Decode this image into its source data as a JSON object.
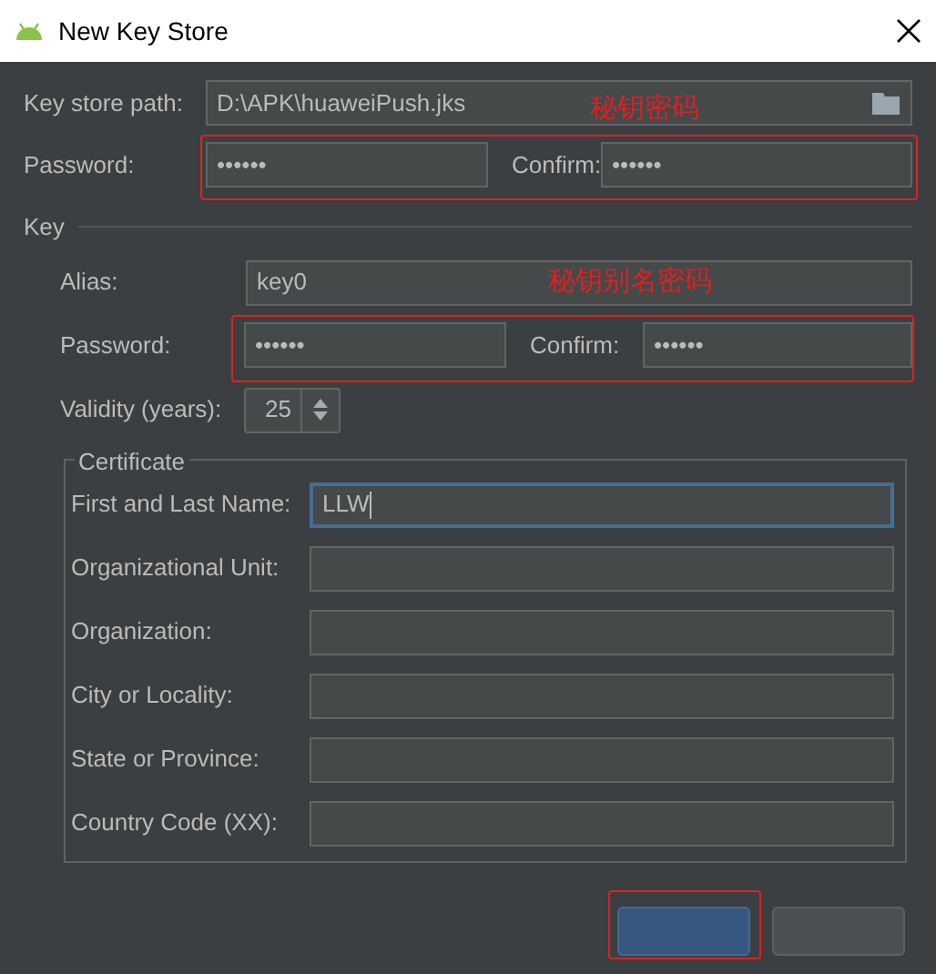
{
  "window": {
    "title": "New Key Store"
  },
  "key_store": {
    "path_label": "Key store path:",
    "path": "D:\\APK\\huaweiPush.jks",
    "password_label": "Password:",
    "password": "••••••",
    "confirm_label": "Confirm:",
    "confirm": "••••••"
  },
  "key": {
    "title": "Key",
    "alias_label": "Alias:",
    "alias": "key0",
    "password_label": "Password:",
    "password": "••••••",
    "confirm_label": "Confirm:",
    "confirm": "••••••",
    "validity_label": "Validity (years):",
    "validity": "25"
  },
  "certificate": {
    "title": "Certificate",
    "fields": [
      {
        "label": "First and Last Name:",
        "value": "LLW",
        "focused": true
      },
      {
        "label": "Organizational Unit:",
        "focused": false
      },
      {
        "label": "Organization:",
        "focused": false
      },
      {
        "label": "City or Locality:",
        "focused": false
      },
      {
        "label": "State or Province:",
        "focused": false
      },
      {
        "label": "Country Code (XX):",
        "focused": false
      }
    ]
  },
  "buttons": [
    {
      "kind": "primary"
    },
    {
      "kind": "secondary"
    }
  ],
  "annotations": [
    {
      "text": "秘钥密码"
    },
    {
      "text": "秘钥别名密码"
    }
  ]
}
